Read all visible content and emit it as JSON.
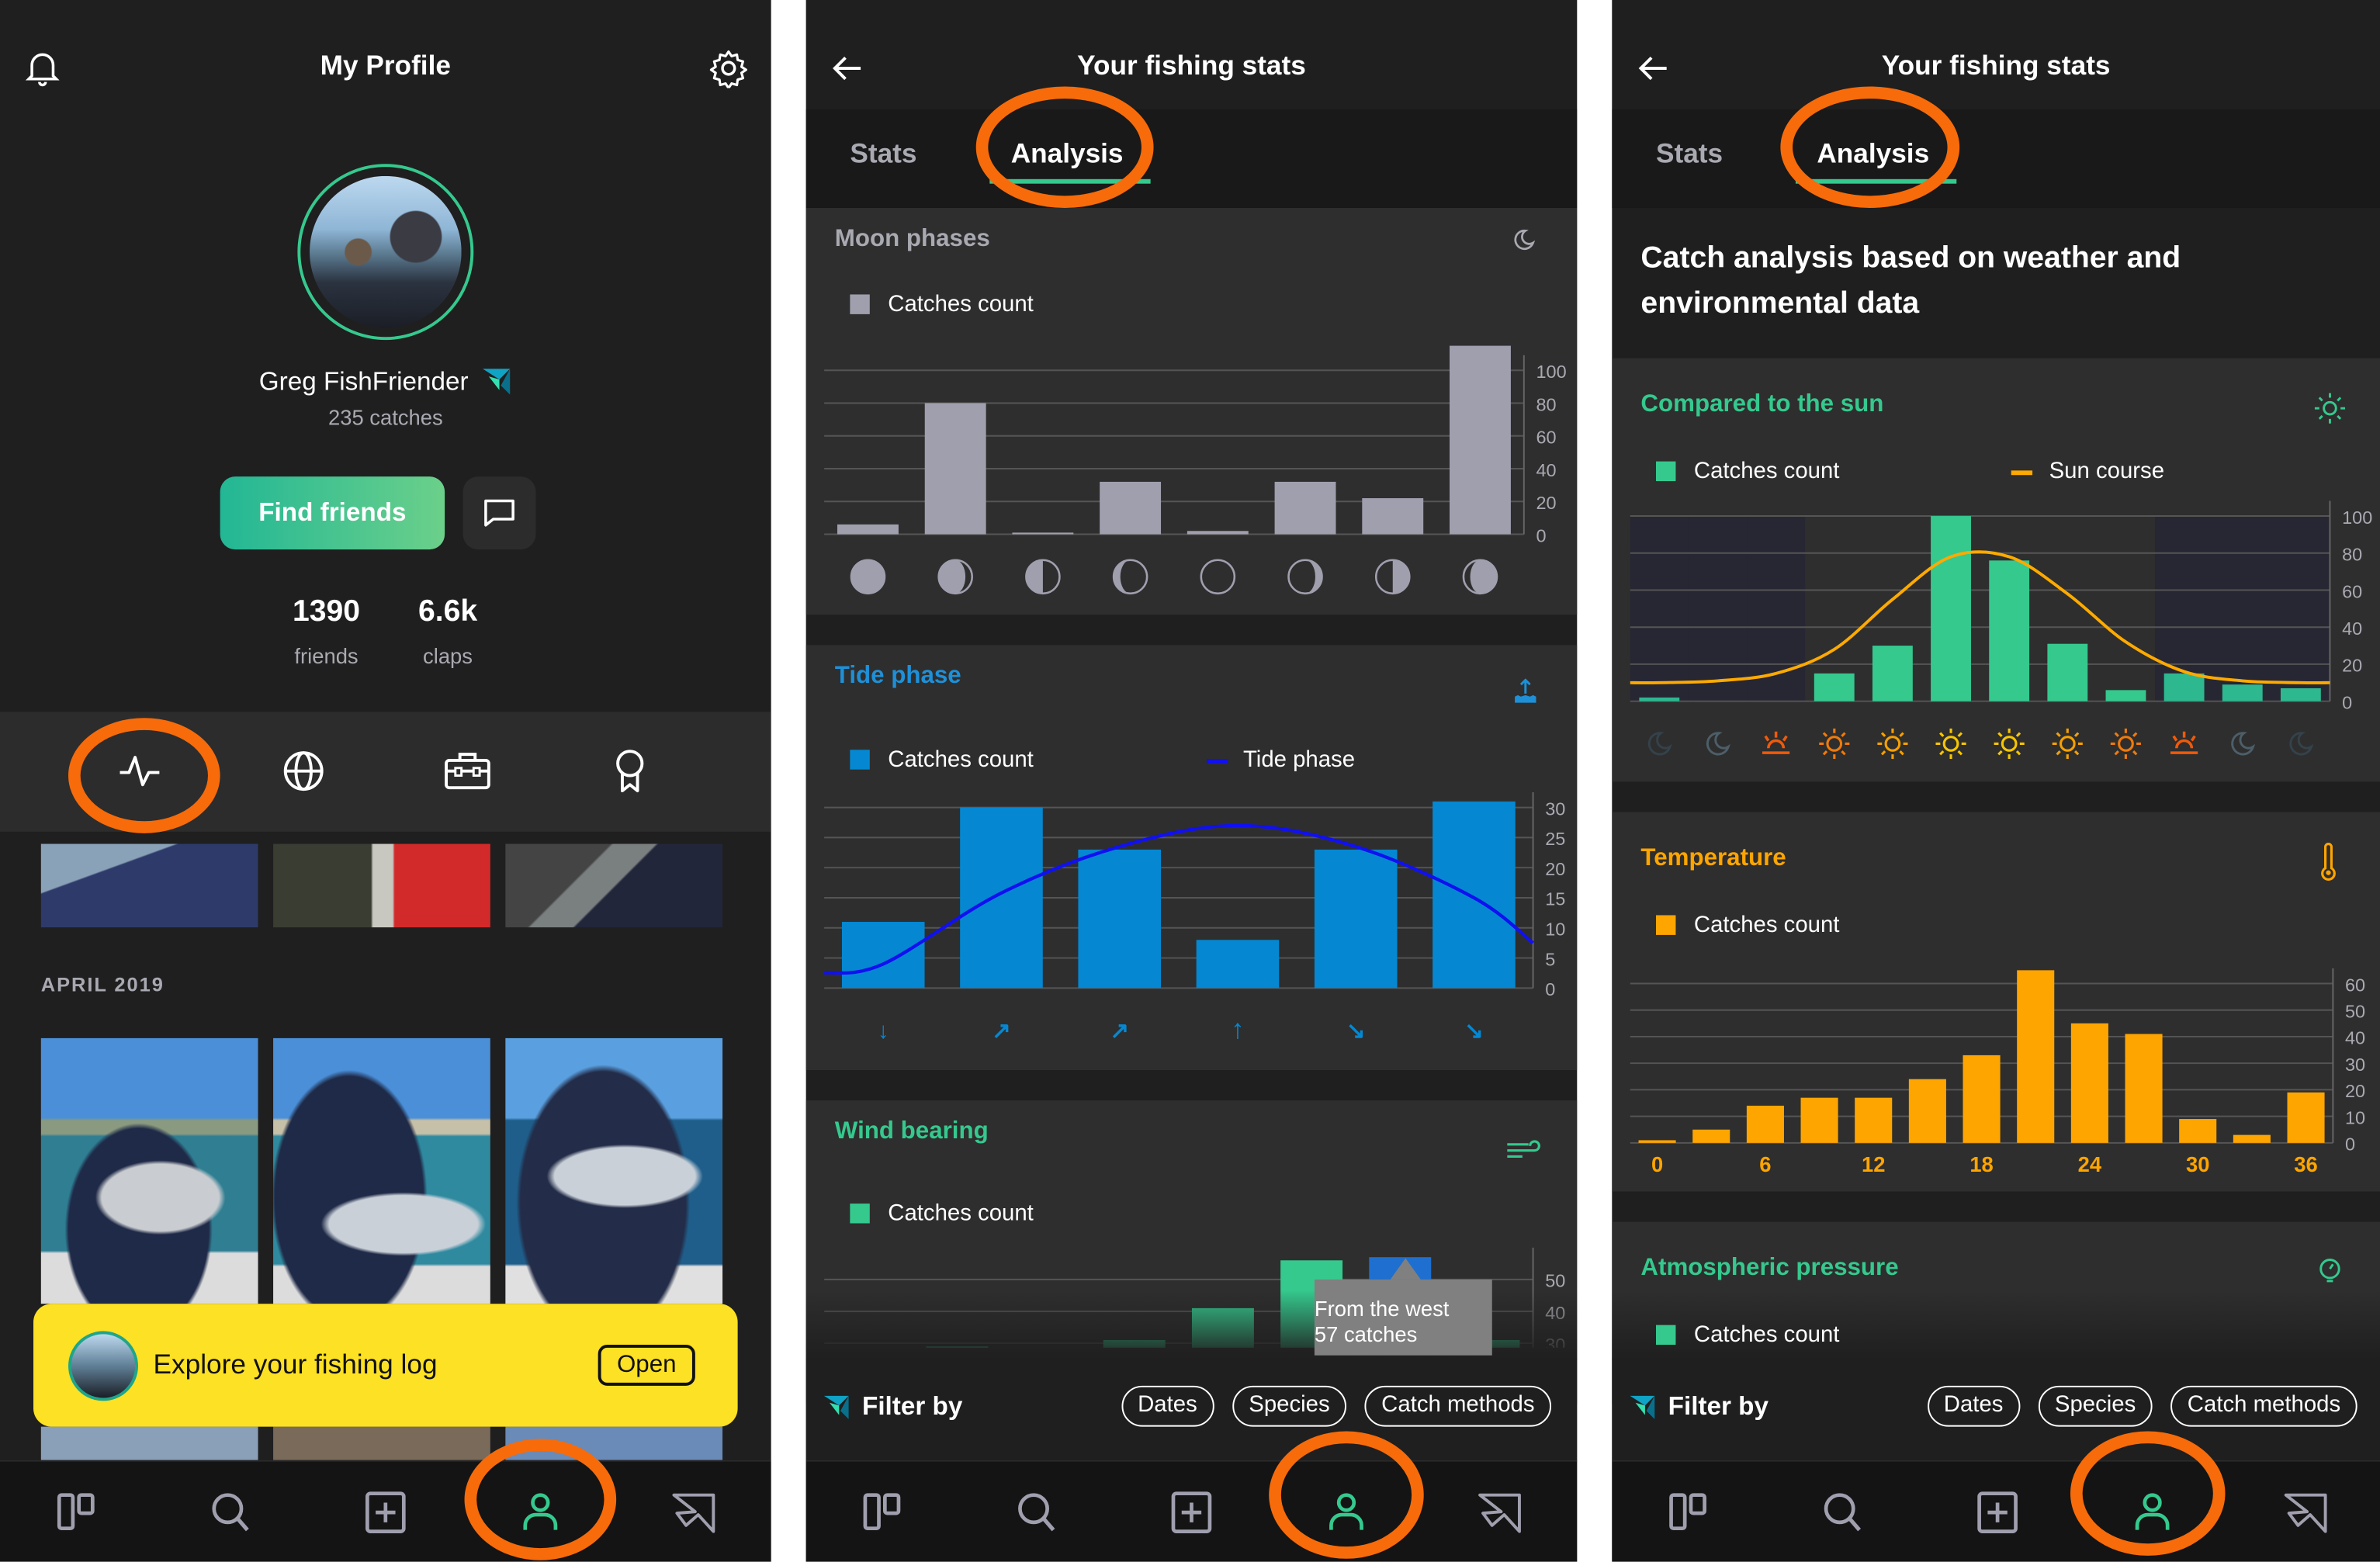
{
  "colors": {
    "accent_green": "#35c98e",
    "tide_blue": "#0588d1",
    "tide_line": "#1010f0",
    "moon_gray": "#a09fae",
    "temperature_orange": "#ffa500",
    "sun_line": "#ffaa00",
    "highlight_ring": "#f76b0a",
    "banner_yellow": "#fde124",
    "wind_selected": "#1e6fcf"
  },
  "profile": {
    "title": "My Profile",
    "name": "Greg FishFriender",
    "catches": "235 catches",
    "find_friends": "Find friends",
    "stats": [
      {
        "value": "1390",
        "label": "friends"
      },
      {
        "value": "6.6k",
        "label": "claps"
      }
    ],
    "tab_icons": [
      "activity-icon",
      "globe-icon",
      "tackle-box-icon",
      "award-icon"
    ],
    "active_tab_icon": "activity-icon",
    "section_label": "APRIL 2019",
    "banner": {
      "text": "Explore your fishing log",
      "button": "Open"
    }
  },
  "stats_screen": {
    "title": "Your fishing stats",
    "tabs": [
      "Stats",
      "Analysis"
    ],
    "active_tab": "Analysis",
    "headline": "Catch analysis based on weather and environmental data",
    "wind_tooltip": {
      "line1": "From the west",
      "line2": "57 catches"
    },
    "pressure": {
      "title": "Atmospheric pressure",
      "legend": "Catches count"
    }
  },
  "filter": {
    "label": "Filter by",
    "pills": [
      "Dates",
      "Species",
      "Catch methods"
    ]
  },
  "nav": {
    "items": [
      "feed-icon",
      "search-icon",
      "add-catch-icon",
      "profile-icon",
      "fishfriender-icon"
    ],
    "active": "profile-icon"
  },
  "chart_data": [
    {
      "type": "bar",
      "title": "Moon phases",
      "legend": [
        "Catches count"
      ],
      "x_icons": [
        "full-moon",
        "waning-gibbous",
        "last-quarter",
        "waning-crescent",
        "new-moon",
        "waxing-crescent",
        "first-quarter",
        "waxing-gibbous"
      ],
      "values": [
        6,
        80,
        1,
        32,
        2,
        32,
        22,
        115
      ],
      "ylim": [
        0,
        100
      ],
      "yticks": [
        0,
        20,
        40,
        60,
        80,
        100
      ],
      "grid": true,
      "color": "#a09fae"
    },
    {
      "type": "bar",
      "title": "Tide phase",
      "legend": [
        "Catches count",
        "Tide phase"
      ],
      "x_icons": [
        "arrow-down",
        "arrow-up-right",
        "arrow-up-right",
        "arrow-up",
        "arrow-down-right",
        "arrow-down-right"
      ],
      "values": [
        11,
        30,
        23,
        8,
        23,
        31
      ],
      "tide_line": {
        "start": 2.5,
        "values": [
          4,
          15.8,
          23.5,
          27,
          23.5,
          15
        ],
        "end": 7.5
      },
      "ylim": [
        0,
        30
      ],
      "yticks": [
        0,
        5,
        10,
        15,
        20,
        25,
        30
      ],
      "grid": true,
      "color": "#0588d1"
    },
    {
      "type": "bar",
      "title": "Wind bearing",
      "legend": [
        "Catches count"
      ],
      "values": [
        null,
        29,
        null,
        31,
        41,
        56,
        57,
        31
      ],
      "selected_index": 6,
      "yticks": [
        30,
        40,
        50
      ],
      "grid": true,
      "color": "#35c98e"
    },
    {
      "type": "bar",
      "title": "Compared to the sun",
      "legend": [
        "Catches count",
        "Sun course"
      ],
      "x_icons": [
        "night",
        "moon",
        "sunrise",
        "sun-rising",
        "sun",
        "sun",
        "sun",
        "sun",
        "sun-setting",
        "sunset",
        "moon",
        "night"
      ],
      "night_slots": [
        0,
        1,
        2,
        9,
        10,
        11
      ],
      "values": [
        2,
        0,
        0,
        15,
        30,
        100,
        76,
        31,
        6,
        15,
        9,
        7
      ],
      "sun_course": [
        10,
        11,
        15,
        28,
        55,
        78,
        78,
        58,
        32,
        16,
        11,
        10
      ],
      "ylim": [
        0,
        100
      ],
      "yticks": [
        0,
        20,
        40,
        60,
        80,
        100
      ],
      "grid": true,
      "color": "#35c98e"
    },
    {
      "type": "bar",
      "title": "Temperature",
      "legend": [
        "Catches count"
      ],
      "categories": [
        0,
        3,
        6,
        9,
        12,
        15,
        18,
        21,
        24,
        27,
        30,
        33,
        36
      ],
      "xticks": [
        "0",
        "6",
        "12",
        "18",
        "24",
        "30",
        "36"
      ],
      "values": [
        1,
        5,
        14,
        17,
        17,
        24,
        33,
        65,
        45,
        41,
        9,
        3,
        19
      ],
      "ylim": [
        0,
        60
      ],
      "yticks": [
        0,
        10,
        20,
        30,
        40,
        50,
        60
      ],
      "grid": true,
      "color": "#ffa500"
    }
  ]
}
